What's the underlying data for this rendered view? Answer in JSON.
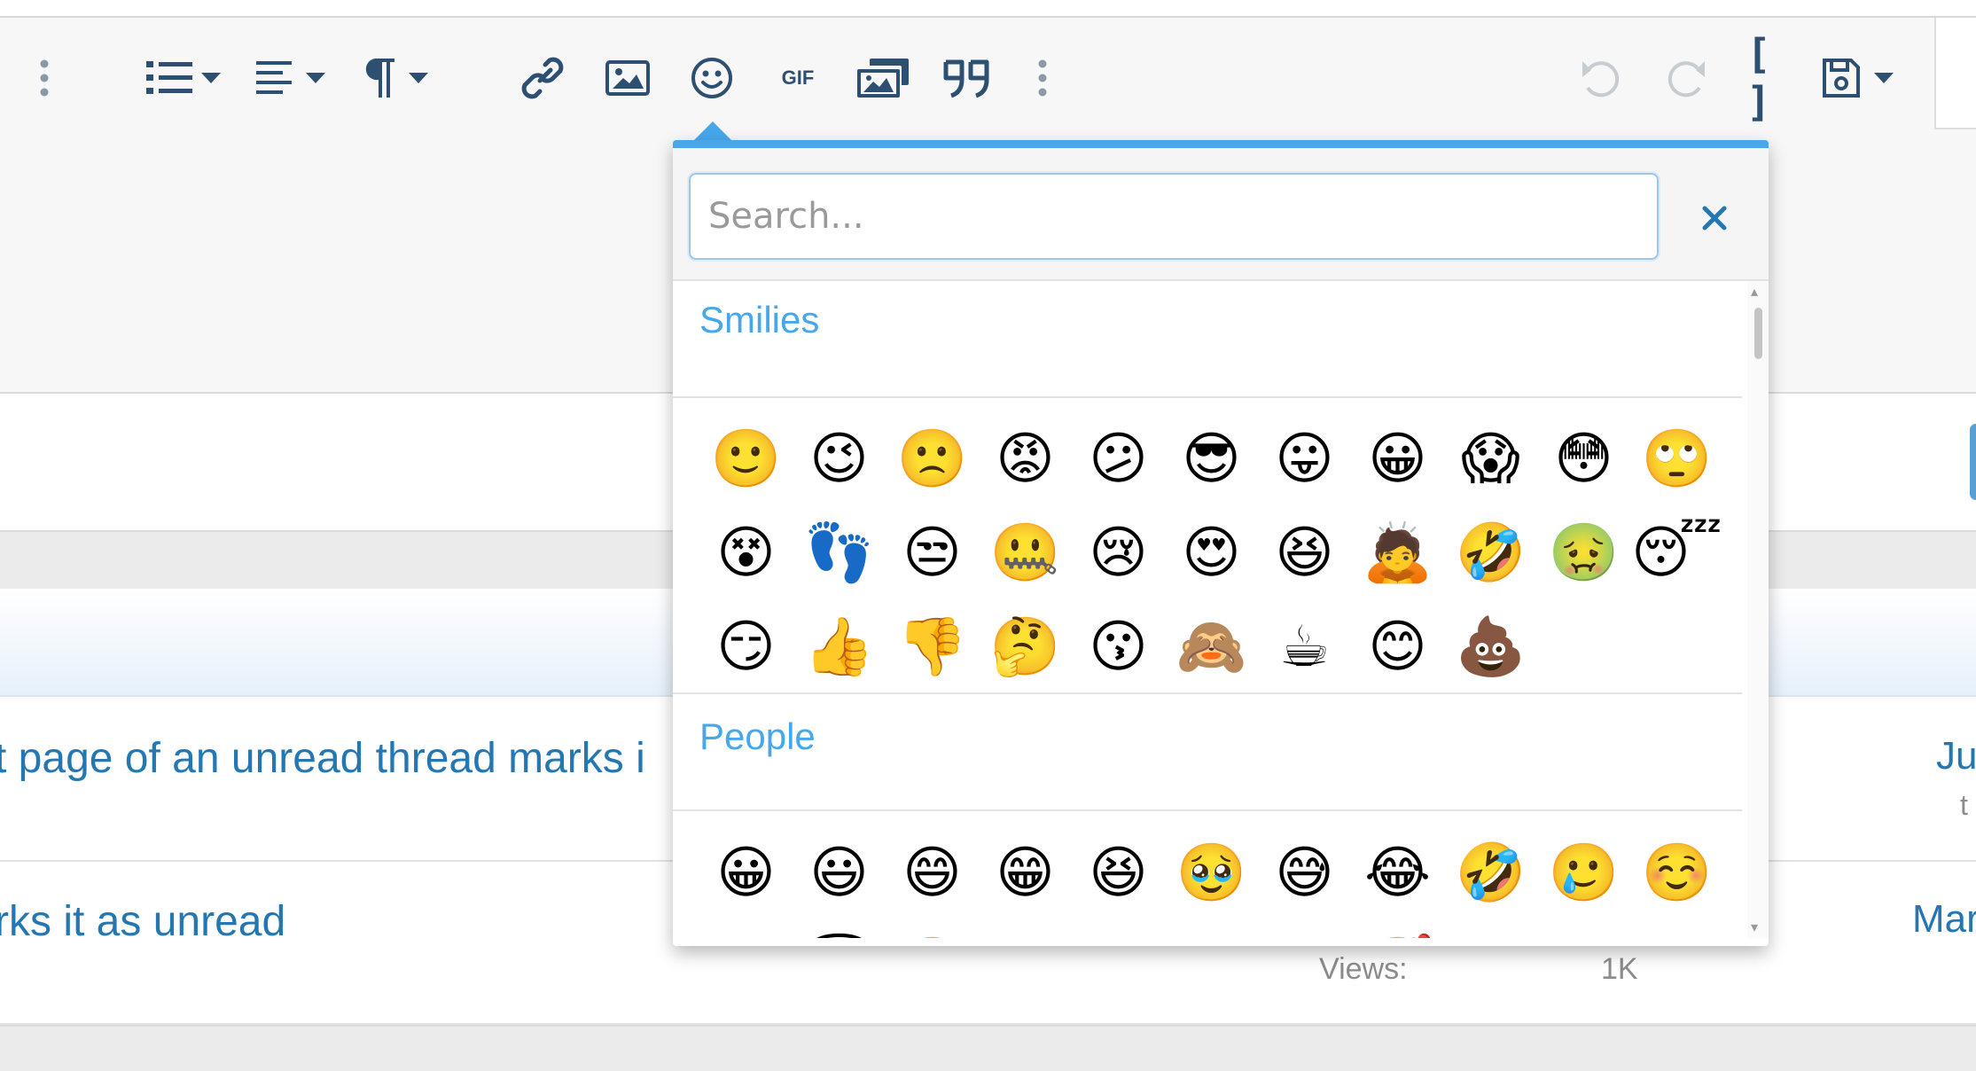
{
  "toolbar": {
    "buttons": [
      {
        "name": "more-options-left",
        "icon": "vertical-dots-icon"
      },
      {
        "name": "list",
        "icon": "list-icon"
      },
      {
        "name": "align",
        "icon": "align-left-icon"
      },
      {
        "name": "paragraph",
        "icon": "paragraph-icon"
      },
      {
        "name": "link",
        "icon": "link-icon"
      },
      {
        "name": "image",
        "icon": "image-icon"
      },
      {
        "name": "emoji",
        "icon": "smiley-icon"
      },
      {
        "name": "gif",
        "icon": "gif-icon",
        "label": "GIF"
      },
      {
        "name": "media",
        "icon": "media-gallery-icon"
      },
      {
        "name": "quote",
        "icon": "quote-icon"
      },
      {
        "name": "more-options-right",
        "icon": "vertical-dots-icon"
      },
      {
        "name": "undo",
        "icon": "undo-icon"
      },
      {
        "name": "redo",
        "icon": "redo-icon"
      },
      {
        "name": "toggle-bbcode",
        "icon": "brackets-icon",
        "label": "[ ]"
      },
      {
        "name": "drafts",
        "icon": "save-icon"
      }
    ]
  },
  "emoji_menu": {
    "search_placeholder": "Search...",
    "categories": [
      {
        "title": "Smilies",
        "emojis": [
          "🙂",
          "😉",
          "🙁",
          "😡",
          "😕",
          "😎",
          "😛",
          "😀",
          "😱",
          "😳",
          "🙄",
          "😵",
          "👣",
          "😒",
          "🤐",
          "😢",
          "😍",
          "😆",
          "🙇",
          "🤣",
          "🤢",
          "😴",
          "😏",
          "👍",
          "👎",
          "🤔",
          "😗",
          "🙈",
          "☕",
          "😊",
          "💩"
        ]
      },
      {
        "title": "People",
        "emojis": [
          "😀",
          "😃",
          "😄",
          "😁",
          "😆",
          "🥹",
          "😅",
          "😂",
          "🤣",
          "🥲",
          "☺️",
          "😊",
          "😇",
          "🙂",
          "🙃",
          "😉",
          "😌",
          "😍",
          "🥰",
          "😘",
          "😗",
          "😙"
        ]
      }
    ]
  },
  "threads": [
    {
      "title": "t page of an unread thread marks i",
      "side": "Jul",
      "sub": "t"
    },
    {
      "title": "rks it as unread",
      "side": "Mar"
    }
  ],
  "stats": {
    "views_label": "Views:",
    "views_value": "1K"
  },
  "colors": {
    "accent": "#47a7eb",
    "link": "#2577b1",
    "icon": "#2d5072"
  }
}
